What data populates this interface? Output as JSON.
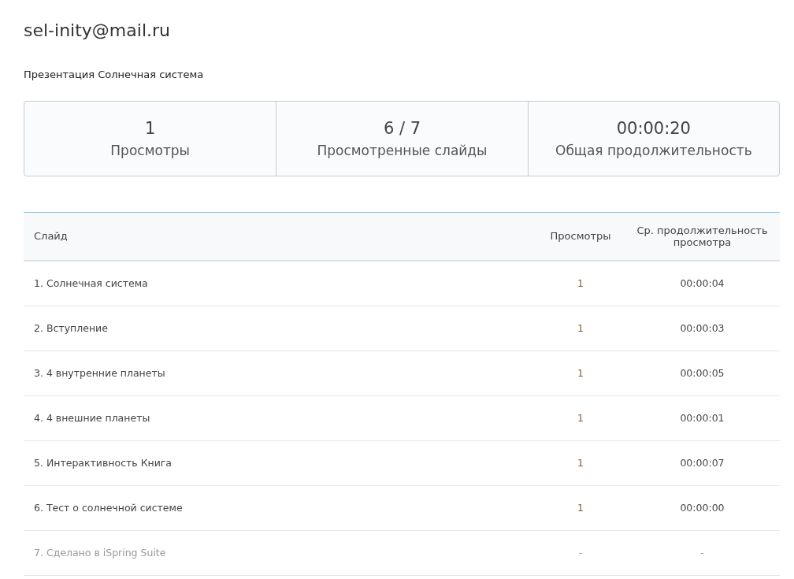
{
  "user_email": "sel-inity@mail.ru",
  "presentation_title": "Презентация Солнечная система",
  "summary": [
    {
      "value": "1",
      "label": "Просмотры"
    },
    {
      "value": "6 / 7",
      "label": "Просмотренные слайды"
    },
    {
      "value": "00:00:20",
      "label": "Общая продолжительность"
    }
  ],
  "table": {
    "columns": [
      "Слайд",
      "Просмотры",
      "Ср. продолжительность просмотра"
    ],
    "rows": [
      {
        "slide": "1. Солнечная система",
        "views": "1",
        "avg_duration": "00:00:04",
        "viewed": true
      },
      {
        "slide": "2. Вступление",
        "views": "1",
        "avg_duration": "00:00:03",
        "viewed": true
      },
      {
        "slide": "3. 4 внутренние планеты",
        "views": "1",
        "avg_duration": "00:00:05",
        "viewed": true
      },
      {
        "slide": "4. 4 внешние планеты",
        "views": "1",
        "avg_duration": "00:00:01",
        "viewed": true
      },
      {
        "slide": "5. Интерактивность Книга",
        "views": "1",
        "avg_duration": "00:00:07",
        "viewed": true
      },
      {
        "slide": "6. Тест о солнечной системе",
        "views": "1",
        "avg_duration": "00:00:00",
        "viewed": true
      },
      {
        "slide": "7. Сделано в iSpring Suite",
        "views": "-",
        "avg_duration": "-",
        "viewed": false
      }
    ]
  }
}
